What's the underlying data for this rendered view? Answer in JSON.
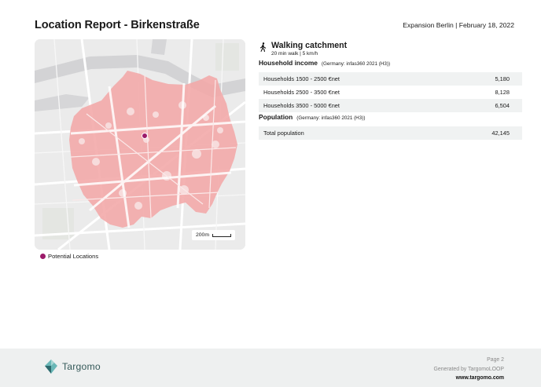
{
  "header": {
    "title": "Location Report - Birkenstraße",
    "meta": "Expansion Berlin | February 18, 2022"
  },
  "map": {
    "scale_label": "200m",
    "catchment_color": "#f2a7a7",
    "marker_color": "#9c1b6a"
  },
  "legend": {
    "label": "Potential Locations",
    "color": "#9c1b6a"
  },
  "catchment": {
    "icon": "walking-person-icon",
    "title": "Walking catchment",
    "subtitle": "20 min walk | 5 km/h"
  },
  "household": {
    "title": "Household income",
    "source": "(Germany: infas360 2021 (H3))",
    "rows": [
      {
        "label": "Households 1500 - 2500 €net",
        "value": "5,180"
      },
      {
        "label": "Households 2500 - 3500 €net",
        "value": "8,128"
      },
      {
        "label": "Households 3500 - 5000 €net",
        "value": "6,504"
      }
    ]
  },
  "population": {
    "title": "Population",
    "source": "(Germany: infas360 2021 (H3))",
    "rows": [
      {
        "label": "Total population",
        "value": "42,145"
      }
    ]
  },
  "footer": {
    "brand": "Targomo",
    "page": "Page 2",
    "generated": "Generated by TargomoLOOP",
    "url": "www.targomo.com"
  }
}
